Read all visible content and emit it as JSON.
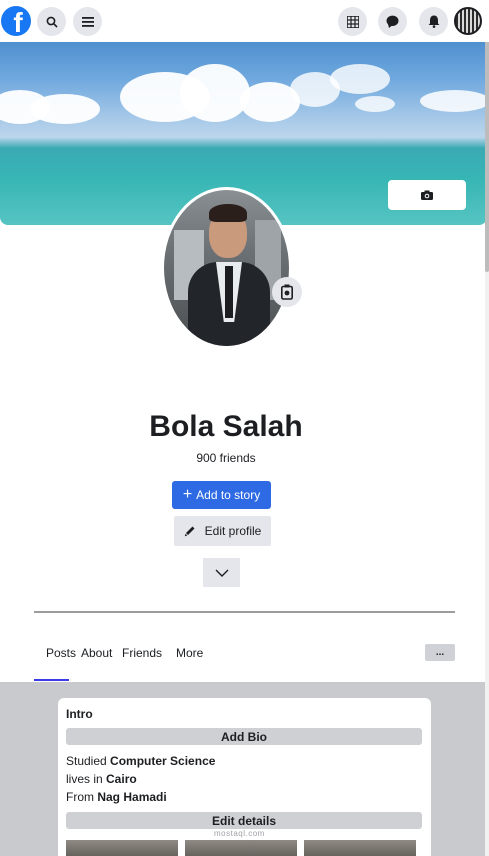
{
  "app": {
    "brand": "f"
  },
  "topbar": {
    "icons": [
      "facebook-logo",
      "search-icon",
      "menu-icon",
      "grid-icon",
      "messenger-icon",
      "bell-icon",
      "avatar"
    ]
  },
  "profile": {
    "name": "Bola Salah",
    "friends": "900 friends"
  },
  "actions": {
    "add_story": "Add to story",
    "add_story_icon": "+",
    "edit_profile": "Edit profile"
  },
  "tabs": [
    {
      "label": "Posts",
      "active": true
    },
    {
      "label": "About"
    },
    {
      "label": "Friends"
    },
    {
      "label": "More"
    }
  ],
  "more_button": "...",
  "intro": {
    "title": "Intro",
    "add_bio": "Add Bio",
    "studied_prefix": "Studied ",
    "studied": "Computer Science",
    "lives_prefix": "lives in ",
    "lives": "Cairo",
    "from_prefix": "From ",
    "from": "Nag Hamadi",
    "edit_details": "Edit details"
  },
  "watermark": "mostaql.com",
  "colors": {
    "brand": "#1877f2",
    "primary_button": "#2d6ae3",
    "tab_active": "#3b3be8",
    "content_bg": "#c9cace"
  }
}
